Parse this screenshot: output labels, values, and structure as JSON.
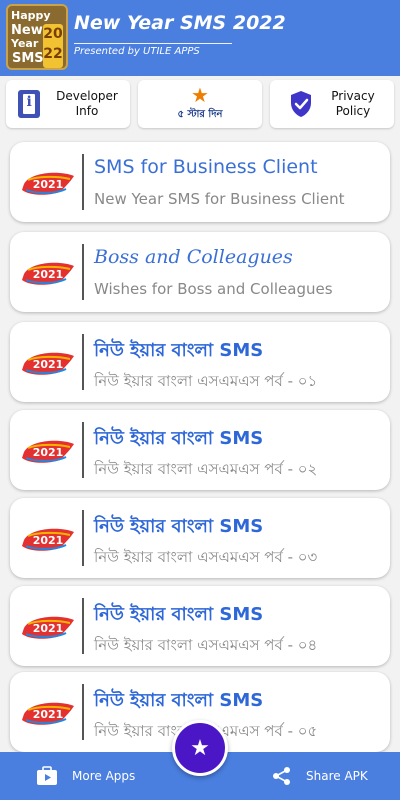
{
  "header": {
    "logo": {
      "line1": "Happy",
      "line2": "New",
      "line3": "Year",
      "line4": "SMS",
      "year_a": "20",
      "year_b": "22"
    },
    "title": "New Year SMS 2022",
    "subtitle": "Presented by UTILE APPS"
  },
  "quick_actions": {
    "developer": {
      "label": "Developer\nInfo",
      "icon": "developer-info-icon",
      "icon_color": "#3f51b5"
    },
    "rate": {
      "label": "৫ স্টার দিন",
      "icon": "star-icon",
      "icon_color": "#ef7d00"
    },
    "privacy": {
      "label": "Privacy\nPolicy",
      "icon": "shield-check-icon",
      "icon_color": "#3f36c9"
    }
  },
  "items": [
    {
      "badge": "2021",
      "title": "SMS for Business Client",
      "subtitle": "New Year SMS for Business Client"
    },
    {
      "badge": "2021",
      "title": "Boss and Colleagues",
      "subtitle": "Wishes for Boss and Colleagues"
    },
    {
      "badge": "2021",
      "title": "নিউ ইয়ার বাংলা SMS",
      "subtitle": "নিউ ইয়ার বাংলা এসএমএস পর্ব - ০১"
    },
    {
      "badge": "2021",
      "title": "নিউ ইয়ার বাংলা SMS",
      "subtitle": "নিউ ইয়ার বাংলা এসএমএস পর্ব - ০২"
    },
    {
      "badge": "2021",
      "title": "নিউ ইয়ার বাংলা SMS",
      "subtitle": "নিউ ইয়ার বাংলা এসএমএস পর্ব - ০৩"
    },
    {
      "badge": "2021",
      "title": "নিউ ইয়ার বাংলা SMS",
      "subtitle": "নিউ ইয়ার বাংলা এসএমএস পর্ব - ০৪"
    },
    {
      "badge": "2021",
      "title": "নিউ ইয়ার বাংলা SMS",
      "subtitle": "নিউ ইয়ার বাংলা এসএমএস পর্ব - ০৫"
    }
  ],
  "bottom_bar": {
    "more_apps": {
      "label": "More Apps",
      "icon": "more-apps-icon"
    },
    "fab": {
      "icon": "star-icon"
    },
    "share": {
      "label": "Share APK",
      "icon": "share-icon"
    }
  },
  "colors": {
    "primary": "#4a7fe0",
    "fab": "#4b16c5",
    "title_blue": "#3a6fd6",
    "subtitle_gray": "#888888"
  }
}
